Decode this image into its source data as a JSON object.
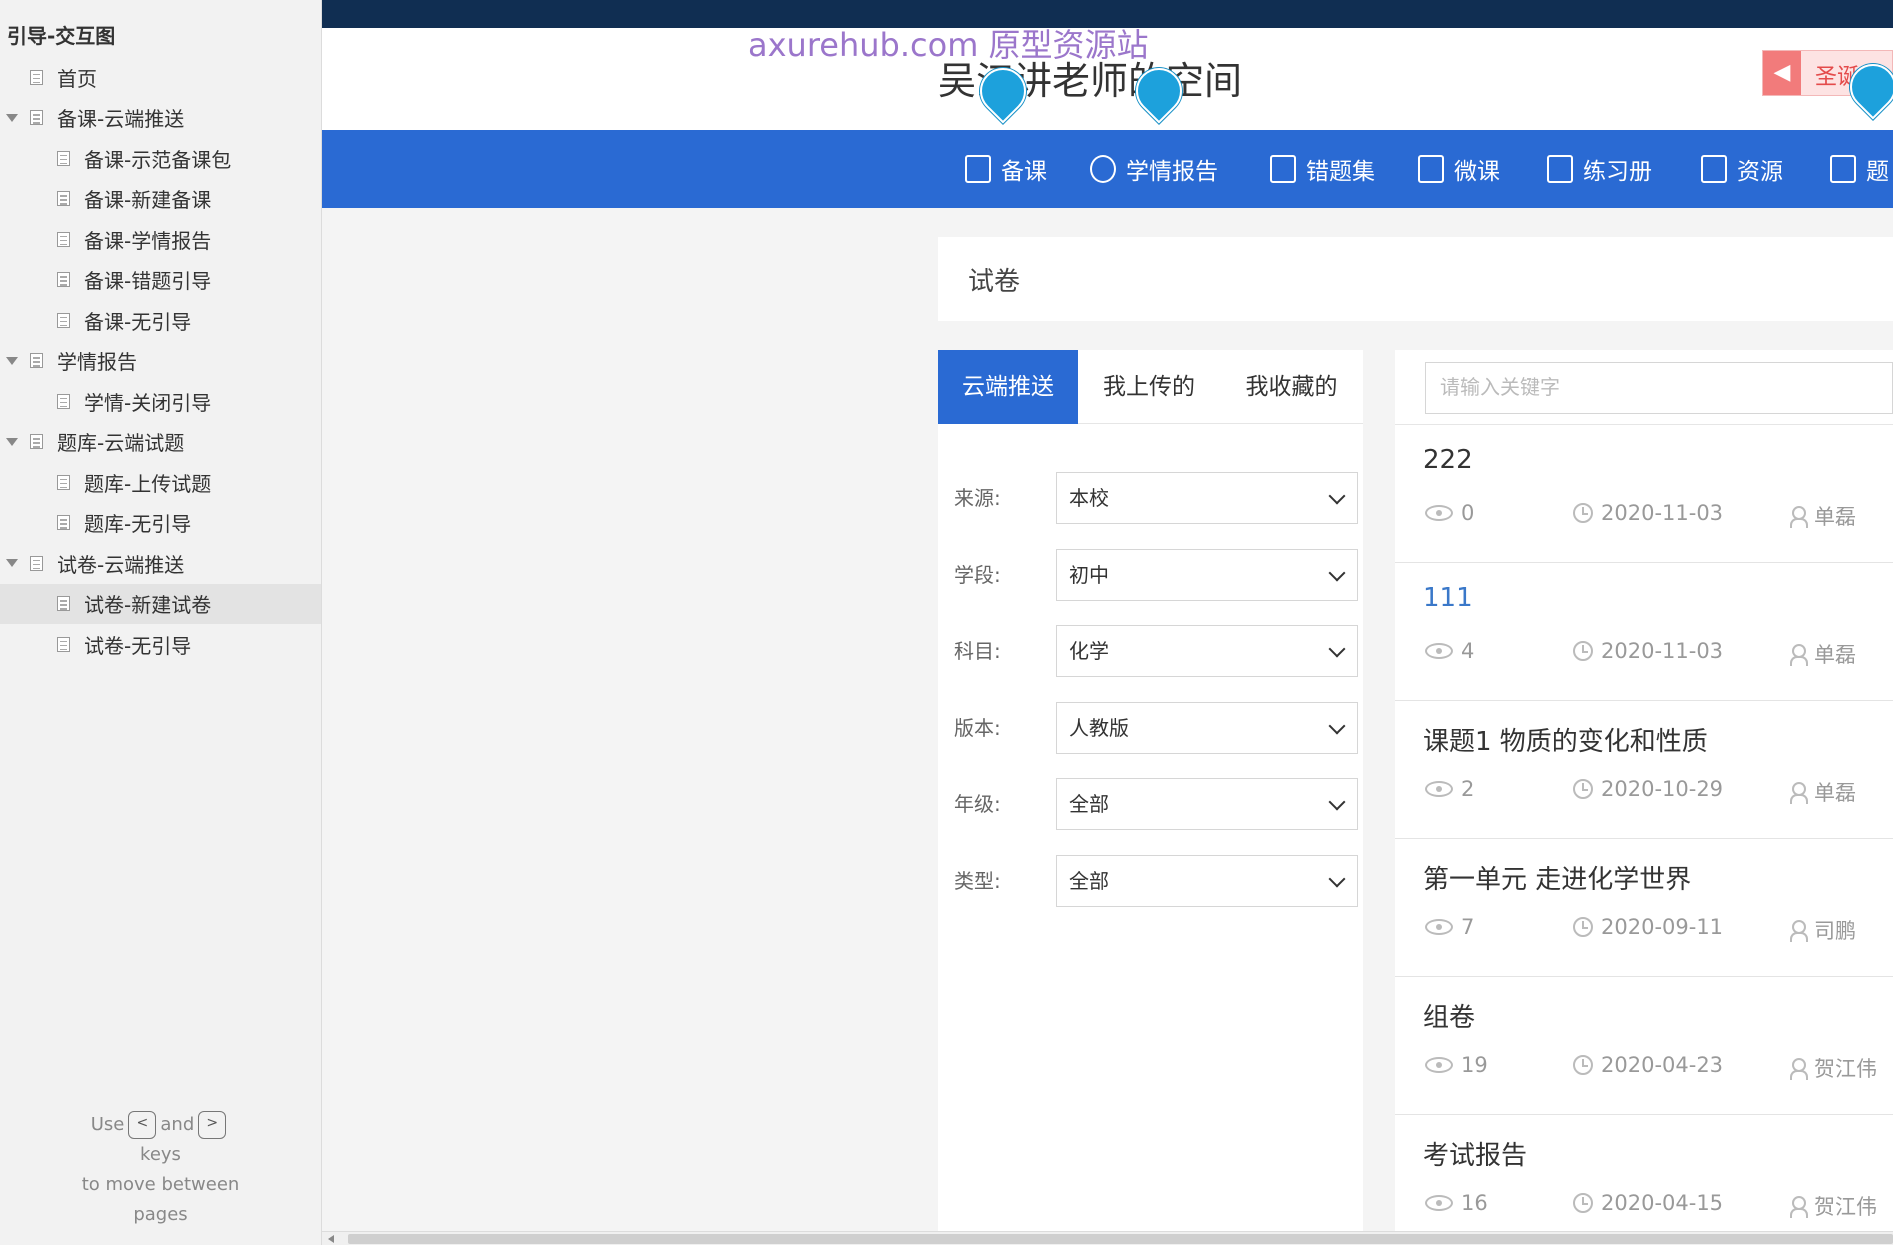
{
  "sidebar": {
    "title": "引导-交互图",
    "items": [
      {
        "label": "首页",
        "level": 0,
        "expandable": false
      },
      {
        "label": "备课-云端推送",
        "level": 0,
        "expandable": true
      },
      {
        "label": "备课-示范备课包",
        "level": 1
      },
      {
        "label": "备课-新建备课",
        "level": 1
      },
      {
        "label": "备课-学情报告",
        "level": 1
      },
      {
        "label": "备课-错题引导",
        "level": 1
      },
      {
        "label": "备课-无引导",
        "level": 1
      },
      {
        "label": "学情报告",
        "level": 0,
        "expandable": true
      },
      {
        "label": "学情-关闭引导",
        "level": 1
      },
      {
        "label": "题库-云端试题",
        "level": 0,
        "expandable": true
      },
      {
        "label": "题库-上传试题",
        "level": 1
      },
      {
        "label": "题库-无引导",
        "level": 1
      },
      {
        "label": "试卷-云端推送",
        "level": 0,
        "expandable": true
      },
      {
        "label": "试卷-新建试卷",
        "level": 1,
        "selected": true
      },
      {
        "label": "试卷-无引导",
        "level": 1
      }
    ],
    "hint": {
      "use": "Use",
      "left_key": "<",
      "and": "and",
      "right_key": ">",
      "keys": "keys",
      "line2": "to move between",
      "line3": "pages"
    }
  },
  "header": {
    "watermark": "axurehub.com 原型资源站",
    "space_title": "吴江讲老师的空间",
    "notice_text": "圣诞"
  },
  "main_nav": [
    {
      "label": "备课",
      "icon": "document-icon"
    },
    {
      "label": "学情报告",
      "icon": "pie-chart-icon"
    },
    {
      "label": "错题集",
      "icon": "book-icon"
    },
    {
      "label": "微课",
      "icon": "video-icon"
    },
    {
      "label": "练习册",
      "icon": "notebook-icon"
    },
    {
      "label": "资源",
      "icon": "briefcase-icon"
    },
    {
      "label": "题",
      "icon": "clipboard-icon"
    }
  ],
  "page_title": "试卷",
  "tabs": [
    "云端推送",
    "我上传的",
    "我收藏的"
  ],
  "filters": [
    {
      "label": "来源:",
      "value": "本校"
    },
    {
      "label": "学段:",
      "value": "初中"
    },
    {
      "label": "科目:",
      "value": "化学"
    },
    {
      "label": "版本:",
      "value": "人教版"
    },
    {
      "label": "年级:",
      "value": "全部"
    },
    {
      "label": "类型:",
      "value": "全部"
    }
  ],
  "search": {
    "placeholder": "请输入关键字"
  },
  "papers": [
    {
      "title": "222",
      "views": "0",
      "date": "2020-11-03",
      "author": "单磊"
    },
    {
      "title": "111",
      "views": "4",
      "date": "2020-11-03",
      "author": "单磊"
    },
    {
      "title": "课题1 物质的变化和性质",
      "views": "2",
      "date": "2020-10-29",
      "author": "单磊"
    },
    {
      "title": "第一单元 走进化学世界",
      "views": "7",
      "date": "2020-09-11",
      "author": "司鹏"
    },
    {
      "title": "组卷",
      "views": "19",
      "date": "2020-04-23",
      "author": "贺江伟"
    },
    {
      "title": "考试报告",
      "views": "16",
      "date": "2020-04-15",
      "author": "贺江伟"
    }
  ],
  "colors": {
    "primary": "#2a6ad3",
    "topbar": "#102e52",
    "pin": "#1da1dc",
    "link": "#3a78c9"
  }
}
